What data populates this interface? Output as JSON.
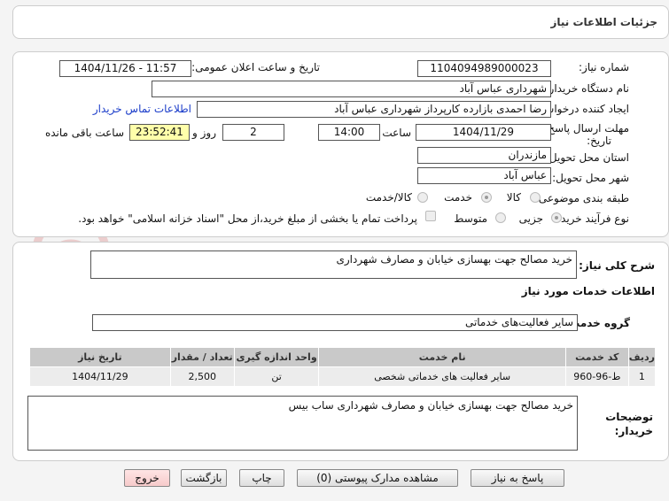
{
  "header": {
    "title": "جزئیات اطلاعات نیاز"
  },
  "info": {
    "need_number_label": "شماره نیاز:",
    "need_number": "1104094989000023",
    "announce_label": "تاریخ و ساعت اعلان عمومی:",
    "announce_value": "1404/11/26 - 11:57",
    "buyer_org_label": "نام دستگاه خریدار:",
    "buyer_org": "شهرداری عباس آباد",
    "creator_label": "ایجاد کننده درخواست:",
    "creator": "رضا احمدی بازارده کارپرداز شهرداری عباس آباد",
    "contact_link": "اطلاعات تماس خریدار",
    "deadline_label_1": "مهلت ارسال پاسخ: تا",
    "deadline_label_2": "تاریخ:",
    "deadline_date": "1404/11/29",
    "time_label": "ساعت",
    "deadline_time": "14:00",
    "days_value": "2",
    "days_label": "روز و",
    "remaining_time": "23:52:41",
    "remaining_label": "ساعت باقی مانده",
    "province_label": "استان محل تحویل:",
    "province": "مازندران",
    "city_label": "شهر محل تحویل:",
    "city": "عباس آباد",
    "category_label": "طبقه بندی موضوعی:",
    "category_options": [
      "کالا",
      "خدمت",
      "کالا/خدمت"
    ],
    "category_selected": "خدمت",
    "process_label": "نوع فرآیند خرید :",
    "process_options": [
      "جزیی",
      "متوسط"
    ],
    "process_selected": "جزیی",
    "payment_note": "پرداخت تمام یا بخشی از مبلغ خرید،از محل \"اسناد خزانه اسلامی\" خواهد بود."
  },
  "details": {
    "summary_label": "شرح کلی نیاز:",
    "summary": "خرید مصالح جهت بهسازی خیابان و مصارف شهرداری",
    "services_heading": "اطلاعات خدمات مورد نیاز",
    "service_group_label": "گروه خدمت:",
    "service_group": "سایر فعالیت‌های خدماتی",
    "table": {
      "columns": [
        "ردیف",
        "کد خدمت",
        "نام خدمت",
        "واحد اندازه گیری",
        "تعداد / مقدار",
        "تاریخ نیاز"
      ],
      "rows": [
        [
          "1",
          "ط-96-960",
          "سایر فعالیت های خدماتی شخصی",
          "تن",
          "2,500",
          "1404/11/29"
        ]
      ]
    },
    "buyer_notes_label_1": "توضیحات",
    "buyer_notes_label_2": "خریدار:",
    "buyer_notes": "خرید مصالح جهت بهسازی خیابان و مصارف شهرداری ساب بیس"
  },
  "buttons": {
    "reply": "پاسخ به نیاز",
    "view_docs": "مشاهده مدارک پیوستی (0)",
    "print": "چاپ",
    "back": "بازگشت",
    "exit": "خروج"
  },
  "watermark": {
    "text": "AriaTender.net"
  },
  "colors": {
    "link": "#1a3cc9",
    "timer_bg": "#ffffaa",
    "exit_bg": "#ffd6d6",
    "watermark": "#e6b3b3"
  }
}
